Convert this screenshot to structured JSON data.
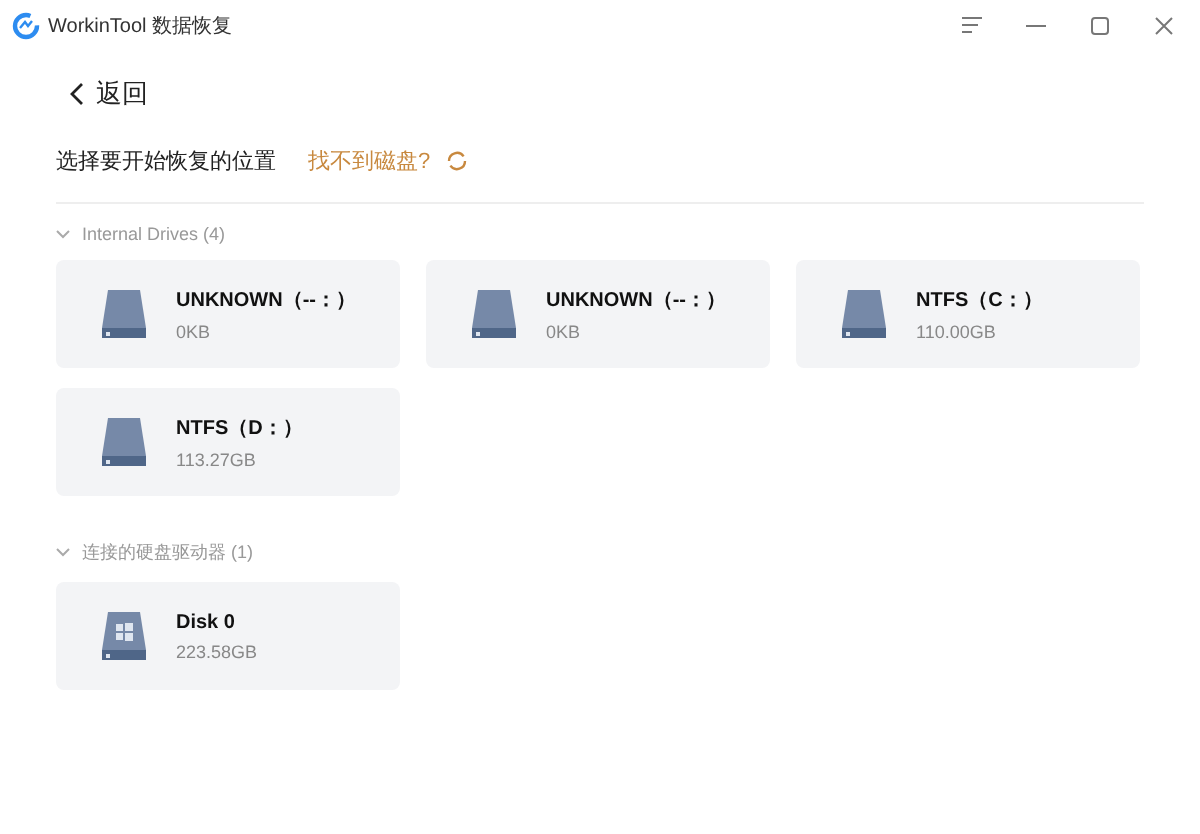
{
  "window": {
    "title": "WorkinTool 数据恢复"
  },
  "back": {
    "label": "返回"
  },
  "prompt": {
    "text": "选择要开始恢复的位置",
    "help_link": "找不到磁盘?"
  },
  "sections": [
    {
      "title": "Internal Drives (4)",
      "expanded": true,
      "drives": [
        {
          "kind": "volume",
          "name": "UNKNOWN（--：）",
          "size": "0KB"
        },
        {
          "kind": "volume",
          "name": "UNKNOWN（--：）",
          "size": "0KB"
        },
        {
          "kind": "volume",
          "name": "NTFS（C：）",
          "size": "110.00GB"
        },
        {
          "kind": "volume",
          "name": "NTFS（D：）",
          "size": "113.27GB"
        }
      ]
    },
    {
      "title": "连接的硬盘驱动器 (1)",
      "expanded": true,
      "drives": [
        {
          "kind": "disk",
          "name": "Disk 0",
          "size": "223.58GB"
        }
      ]
    }
  ]
}
